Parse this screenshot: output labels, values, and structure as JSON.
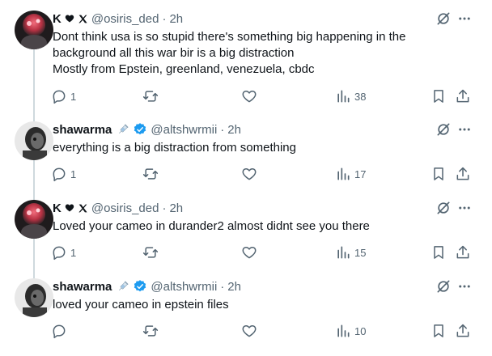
{
  "thread": [
    {
      "display_name": "K",
      "name_emojis": [
        "heart-icon",
        "x-logo-icon"
      ],
      "handle": "@osiris_ded",
      "separator": "·",
      "time": "2h",
      "avatar": "avatar-red-pink",
      "lines": [
        "Dont think usa is so stupid there's something big happening in the",
        "background all this war bir is a big distraction",
        "Mostly from Epstein, greenland, venezuela, cbdc"
      ],
      "replies": "1",
      "retweets": "",
      "likes": "",
      "views": "38"
    },
    {
      "display_name": "shawarma",
      "name_emojis": [
        "syringe-icon",
        "verified-badge-icon"
      ],
      "handle": "@altshwrmii",
      "separator": "·",
      "time": "2h",
      "avatar": "avatar-dark-bw",
      "lines": [
        "everything is a big distraction from something"
      ],
      "replies": "1",
      "retweets": "",
      "likes": "",
      "views": "17"
    },
    {
      "display_name": "K",
      "name_emojis": [
        "heart-icon",
        "x-logo-icon"
      ],
      "handle": "@osiris_ded",
      "separator": "·",
      "time": "2h",
      "avatar": "avatar-red-pink",
      "lines": [
        "Loved your cameo in durander2 almost didnt see you there"
      ],
      "replies": "1",
      "retweets": "",
      "likes": "",
      "views": "15"
    },
    {
      "display_name": "shawarma",
      "name_emojis": [
        "syringe-icon",
        "verified-badge-icon"
      ],
      "handle": "@altshwrmii",
      "separator": "·",
      "time": "2h",
      "avatar": "avatar-dark-bw",
      "lines": [
        "loved your cameo in epstein files"
      ],
      "replies": "",
      "retweets": "",
      "likes": "",
      "views": "10"
    }
  ],
  "colors": {
    "text": "#0f1419",
    "secondary": "#536471",
    "thread_line": "#cfd9de",
    "verified_blue": "#1d9bf0"
  }
}
